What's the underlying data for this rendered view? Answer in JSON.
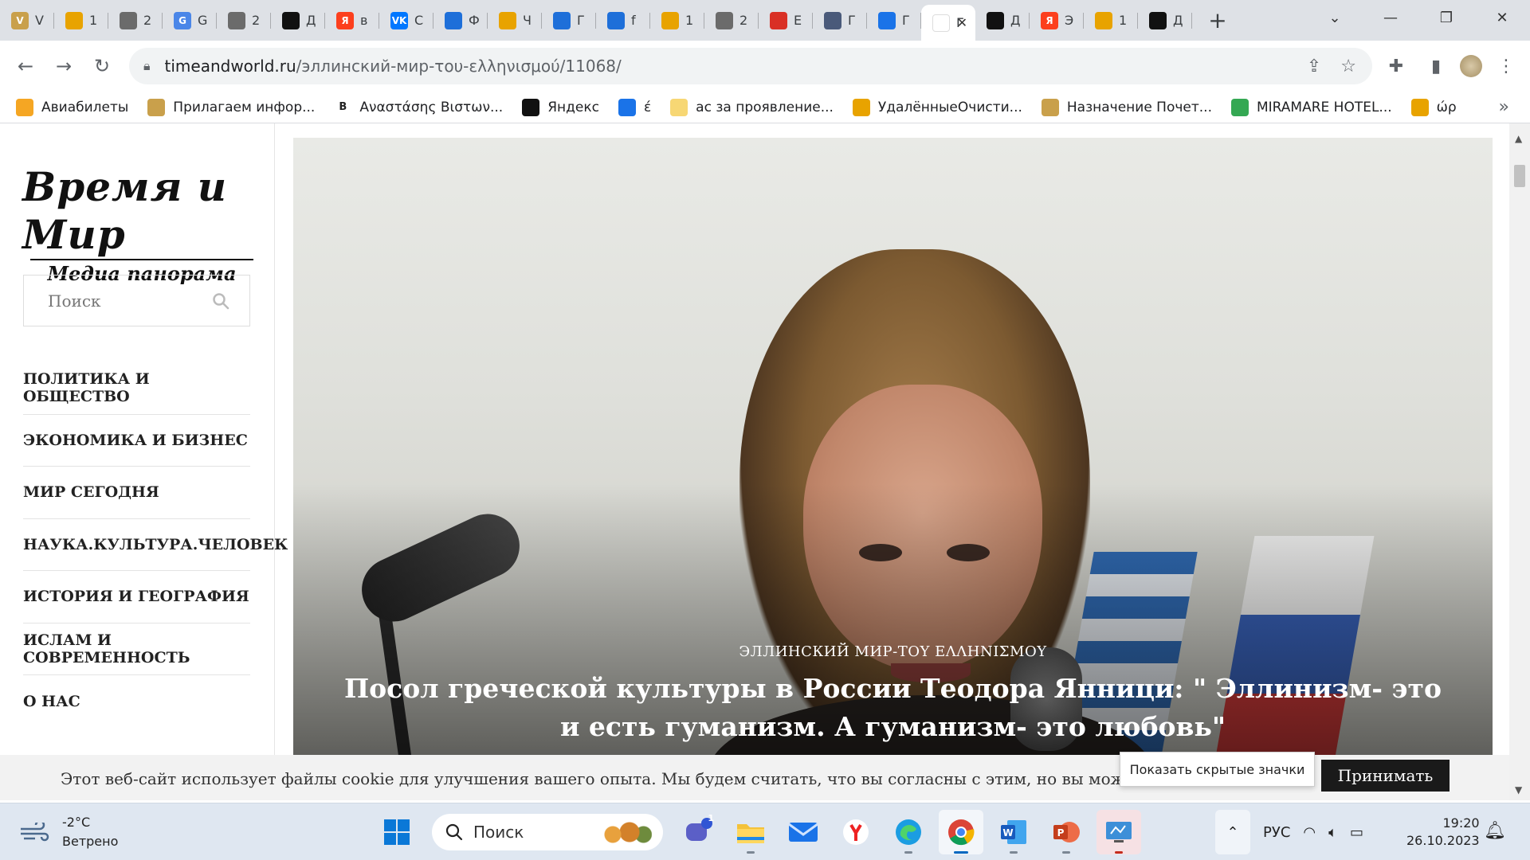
{
  "browser": {
    "tabs": [
      {
        "letter": "V",
        "color": "#c9a04b",
        "title": "V"
      },
      {
        "letter": "",
        "color": "#e8a300",
        "title": "1"
      },
      {
        "letter": "",
        "color": "#6b6b6b",
        "title": "2"
      },
      {
        "letter": "G",
        "color": "#4a86e8",
        "title": "G"
      },
      {
        "letter": "",
        "color": "#6b6b6b",
        "title": "2"
      },
      {
        "letter": "",
        "color": "#111111",
        "title": "Д"
      },
      {
        "letter": "Я",
        "color": "#fc3f1d",
        "title": "в"
      },
      {
        "letter": "VK",
        "color": "#0077ff",
        "title": "С"
      },
      {
        "letter": "",
        "color": "#1e6fd9",
        "title": "Ф"
      },
      {
        "letter": "",
        "color": "#e8a300",
        "title": "Ч"
      },
      {
        "letter": "",
        "color": "#1e6fd9",
        "title": "Г"
      },
      {
        "letter": "",
        "color": "#1e6fd9",
        "title": "f"
      },
      {
        "letter": "",
        "color": "#e8a300",
        "title": "1"
      },
      {
        "letter": "",
        "color": "#6b6b6b",
        "title": "2"
      },
      {
        "letter": "",
        "color": "#d93025",
        "title": "E"
      },
      {
        "letter": "",
        "color": "#4a5a7a",
        "title": "Г"
      },
      {
        "letter": "",
        "color": "#1a73e8",
        "title": "Г"
      },
      {
        "letter": "",
        "color": "#ffffff",
        "title": "Г",
        "active": true
      },
      {
        "letter": "",
        "color": "#111111",
        "title": "Д"
      },
      {
        "letter": "Я",
        "color": "#fc3f1d",
        "title": "Э"
      },
      {
        "letter": "",
        "color": "#e8a300",
        "title": "1"
      },
      {
        "letter": "",
        "color": "#111111",
        "title": "Д"
      }
    ],
    "active_tab_close": "✕",
    "new_tab": "+",
    "url_host": "timeandworld.ru",
    "url_path": "/эллинский-мир-του-ελληνισμού/11068/"
  },
  "bookmarks": [
    {
      "label": "Авиабилеты",
      "color": "#f5a623",
      "icon": "plane-icon"
    },
    {
      "label": "Прилагаем инфор...",
      "color": "#c9a04b",
      "icon": "doc-icon"
    },
    {
      "label": "Αναστάσης Βιστων...",
      "color": "#ffffff",
      "icon": "b-icon",
      "letter": "B"
    },
    {
      "label": "Яндекс",
      "color": "#111111",
      "icon": "yandex-icon"
    },
    {
      "label": "έ",
      "color": "#1a73e8",
      "icon": "mail-icon"
    },
    {
      "label": "ас за проявление...",
      "color": "#f7d774",
      "icon": "note-icon"
    },
    {
      "label": "УдалённыеОчисти...",
      "color": "#e8a300",
      "icon": "envelope-icon"
    },
    {
      "label": "Назначение Почет...",
      "color": "#c9a04b",
      "icon": "doc-icon"
    },
    {
      "label": "MIRAMARE HOTEL...",
      "color": "#34a853",
      "icon": "tripadvisor-icon"
    },
    {
      "label": "ώρ",
      "color": "#e8a300",
      "icon": "envelope-icon"
    }
  ],
  "site": {
    "logo_main": "Время и Мир",
    "logo_sub": "Медиа панорама",
    "search_placeholder": "Поиск",
    "menu": [
      "ПОЛИТИКА И ОБЩЕСТВО",
      "ЭКОНОМИКА И БИЗНЕС",
      "МИР СЕГОДНЯ",
      "НАУКА.КУЛЬТУРА.ЧЕЛОВЕК",
      "ИСТОРИЯ И ГЕОГРАФИЯ",
      "ИСЛАМ И СОВРЕМЕННОСТЬ",
      "О НАС"
    ],
    "hero_category": "ЭЛЛИНСКИЙ МИР-ΤΟΥ ΕΛΛΗΝΙΣΜΟΥ",
    "hero_title": "Посол греческой культуры в России Теодора Янници: \" Эллинизм- это и есть гуманизм. А гуманизм- это любовь\"",
    "cookie_text": "Этот веб-сайт использует файлы cookie для улучшения вашего опыта. Мы будем считать, что вы согласны с этим, но вы можете о",
    "cookie_accept": "Принимать"
  },
  "tooltip": "Показать скрытые значки",
  "taskbar": {
    "temperature": "-2°C",
    "weather": "Ветрено",
    "search_placeholder": "Поиск",
    "chat_badge": "1",
    "language": "РУС",
    "time": "19:20",
    "date": "26.10.2023"
  }
}
